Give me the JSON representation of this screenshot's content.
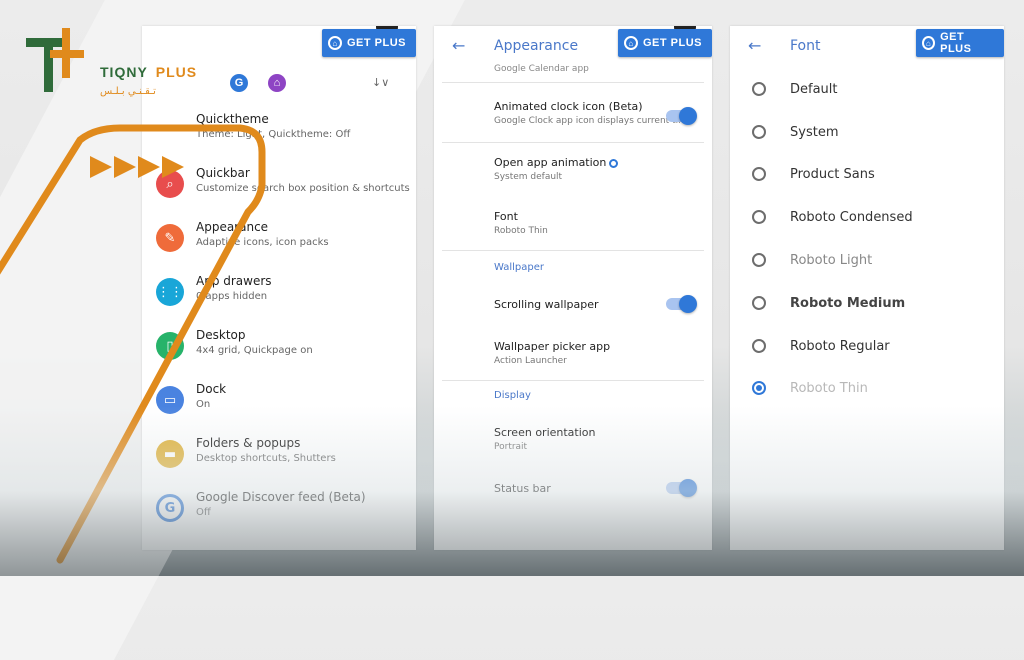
{
  "brand": {
    "name": "TIQNY",
    "plus": "PLUS",
    "arabic": "تـقـنـي  بـلـس",
    "colors": {
      "green": "#2f6b3a",
      "orange": "#e08a1c"
    }
  },
  "get_plus_label": "GET PLUS",
  "accent": "#2f78d8",
  "panel1": {
    "sort_label": "↓∨",
    "top_icons": [
      {
        "letter": "G",
        "color": "#2f78d8",
        "icon": "google-icon"
      },
      {
        "letter": "⌂",
        "color": "#8e44c4",
        "icon": "home-icon"
      }
    ],
    "items": [
      {
        "title": "Quicktheme",
        "subtitle": "Theme: Light, Quicktheme: Off",
        "color": "#ffffff",
        "icon": "none"
      },
      {
        "title": "Quickbar",
        "subtitle": "Customize search box position & shortcuts",
        "color": "#e84d4d",
        "icon": "search-icon",
        "glyph": "⌕"
      },
      {
        "title": "Appearance",
        "subtitle": "Adaptive icons, icon packs",
        "color": "#ef6b3a",
        "icon": "palette-icon",
        "glyph": "✎"
      },
      {
        "title": "App drawers",
        "subtitle": "0 apps hidden",
        "color": "#19a6d8",
        "icon": "grid-icon",
        "glyph": "⋮⋮"
      },
      {
        "title": "Desktop",
        "subtitle": "4x4 grid, Quickpage on",
        "color": "#27b36a",
        "icon": "desktop-icon",
        "glyph": "▯"
      },
      {
        "title": "Dock",
        "subtitle": "On",
        "color": "#4a83e0",
        "icon": "dock-icon",
        "glyph": "▭"
      },
      {
        "title": "Folders & popups",
        "subtitle": "Desktop shortcuts, Shutters",
        "color": "#e0b23a",
        "icon": "folder-icon",
        "glyph": "▬"
      },
      {
        "title": "Google Discover feed (Beta)",
        "subtitle": "Off",
        "color": "#2f78d8",
        "icon": "google-icon",
        "glyph": "G"
      }
    ]
  },
  "panel2": {
    "title": "Appearance",
    "partial_top": "Google Calendar app",
    "items": [
      {
        "title": "Animated clock icon (Beta)",
        "subtitle": "Google Clock app icon displays current time",
        "toggle": true
      },
      {
        "title": "Open app animation",
        "subtitle": "System default",
        "info": true
      },
      {
        "title": "Font",
        "subtitle": "Roboto Thin"
      }
    ],
    "section_wallpaper": "Wallpaper",
    "wallpaper_items": [
      {
        "title": "Scrolling wallpaper",
        "subtitle": "",
        "toggle": true
      },
      {
        "title": "Wallpaper picker app",
        "subtitle": "Action Launcher"
      }
    ],
    "section_display": "Display",
    "display_items": [
      {
        "title": "Screen orientation",
        "subtitle": "Portrait"
      },
      {
        "title": "Status bar",
        "subtitle": "",
        "toggle": true
      }
    ]
  },
  "panel3": {
    "title": "Font",
    "options": [
      {
        "label": "Default",
        "selected": false,
        "tone": "normal"
      },
      {
        "label": "System",
        "selected": false,
        "tone": "normal"
      },
      {
        "label": "Product Sans",
        "selected": false,
        "tone": "normal"
      },
      {
        "label": "Roboto Condensed",
        "selected": false,
        "tone": "normal"
      },
      {
        "label": "Roboto Light",
        "selected": false,
        "tone": "light"
      },
      {
        "label": "Roboto Medium",
        "selected": false,
        "tone": "normal"
      },
      {
        "label": "Roboto Regular",
        "selected": false,
        "tone": "normal"
      },
      {
        "label": "Roboto Thin",
        "selected": true,
        "tone": "faint"
      }
    ]
  }
}
